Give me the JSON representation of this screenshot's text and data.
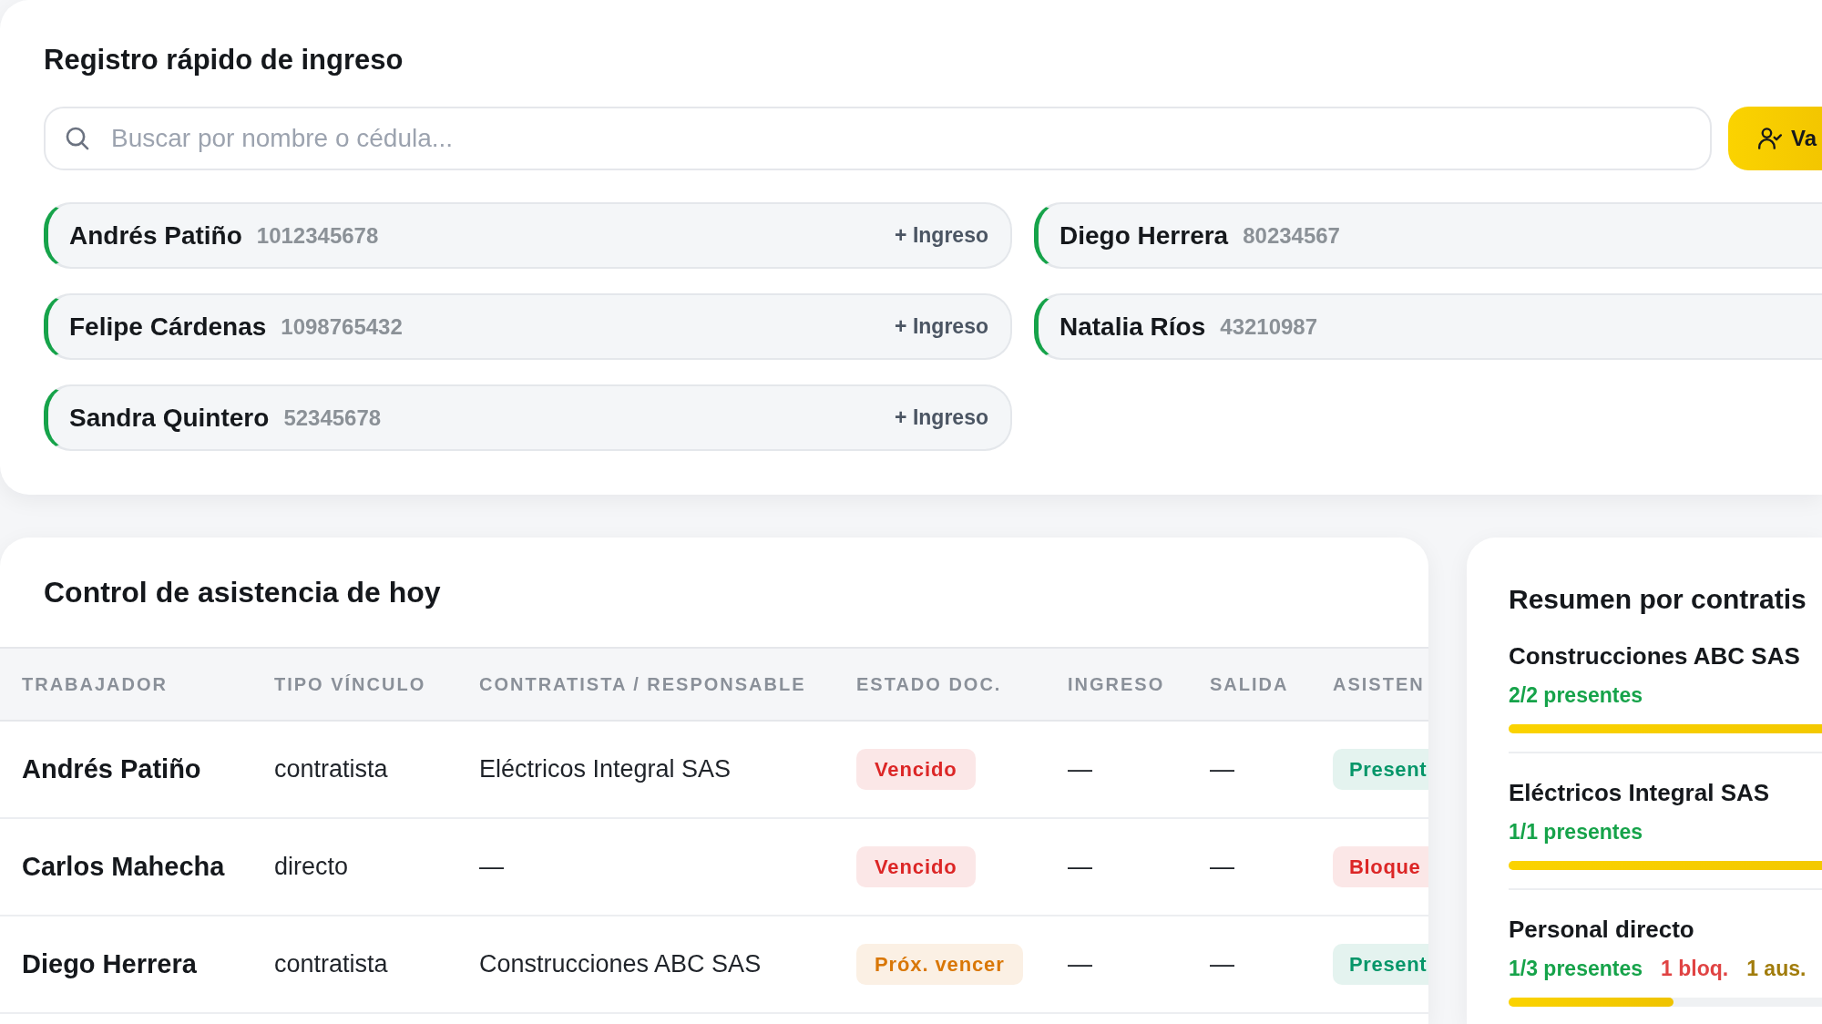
{
  "quick_entry": {
    "title": "Registro rápido de ingreso",
    "search": {
      "placeholder": "Buscar por nombre o cédula..."
    },
    "button": {
      "label": "Va"
    },
    "workers": [
      {
        "name": "Andrés Patiño",
        "id_number": "1012345678",
        "action": "+ Ingreso"
      },
      {
        "name": "Diego Herrera",
        "id_number": "80234567"
      },
      {
        "name": "Felipe Cárdenas",
        "id_number": "1098765432",
        "action": "+ Ingreso"
      },
      {
        "name": "Natalia Ríos",
        "id_number": "43210987"
      },
      {
        "name": "Sandra Quintero",
        "id_number": "52345678",
        "action": "+ Ingreso"
      }
    ]
  },
  "attendance": {
    "title": "Control de asistencia de hoy",
    "columns": [
      "TRABAJADOR",
      "TIPO VÍNCULO",
      "CONTRATISTA / RESPONSABLE",
      "ESTADO DOC.",
      "INGRESO",
      "SALIDA",
      "ASISTEN"
    ],
    "rows": [
      {
        "cells": [
          {
            "kind": "name",
            "text": "Andrés Patiño"
          },
          {
            "kind": "text",
            "text": "contratista"
          },
          {
            "kind": "text",
            "text": "Eléctricos Integral SAS"
          },
          {
            "kind": "badge",
            "text": "Vencido",
            "color": "#dc2626"
          },
          {
            "kind": "text",
            "text": "—"
          },
          {
            "kind": "text",
            "text": "—"
          },
          {
            "kind": "badge",
            "text": "Present",
            "color": "#059669"
          }
        ]
      },
      {
        "cells": [
          {
            "kind": "name",
            "text": "Carlos Mahecha"
          },
          {
            "kind": "text",
            "text": "directo"
          },
          {
            "kind": "text",
            "text": "—"
          },
          {
            "kind": "badge",
            "text": "Vencido",
            "color": "#dc2626"
          },
          {
            "kind": "text",
            "text": "—"
          },
          {
            "kind": "text",
            "text": "—"
          },
          {
            "kind": "badge",
            "text": "Bloque",
            "color": "#dc2626"
          }
        ]
      },
      {
        "cells": [
          {
            "kind": "name",
            "text": "Diego Herrera"
          },
          {
            "kind": "text",
            "text": "contratista"
          },
          {
            "kind": "text",
            "text": "Construcciones ABC SAS"
          },
          {
            "kind": "badge",
            "text": "Próx. vencer",
            "color": "#d97706"
          },
          {
            "kind": "text",
            "text": "—"
          },
          {
            "kind": "text",
            "text": "—"
          },
          {
            "kind": "badge",
            "text": "Present",
            "color": "#059669"
          }
        ]
      }
    ]
  },
  "summary": {
    "title": "Resumen por contratis",
    "groups": [
      {
        "name": "Construcciones ABC SAS",
        "stats": [
          {
            "text": "2/2 presentes",
            "color": "#16a34a"
          }
        ],
        "level": 1
      },
      {
        "name": "Eléctricos Integral SAS",
        "stats": [
          {
            "text": "1/1 presentes",
            "color": "#16a34a"
          }
        ],
        "level": 1
      },
      {
        "name": "Personal directo",
        "stats": [
          {
            "text": "1/3 presentes",
            "color": "#16a34a"
          },
          {
            "text": "1 bloq.",
            "color": "#e04343"
          },
          {
            "text": "1 aus.",
            "color": "#a17c0b"
          }
        ],
        "level": 0.333
      }
    ]
  }
}
